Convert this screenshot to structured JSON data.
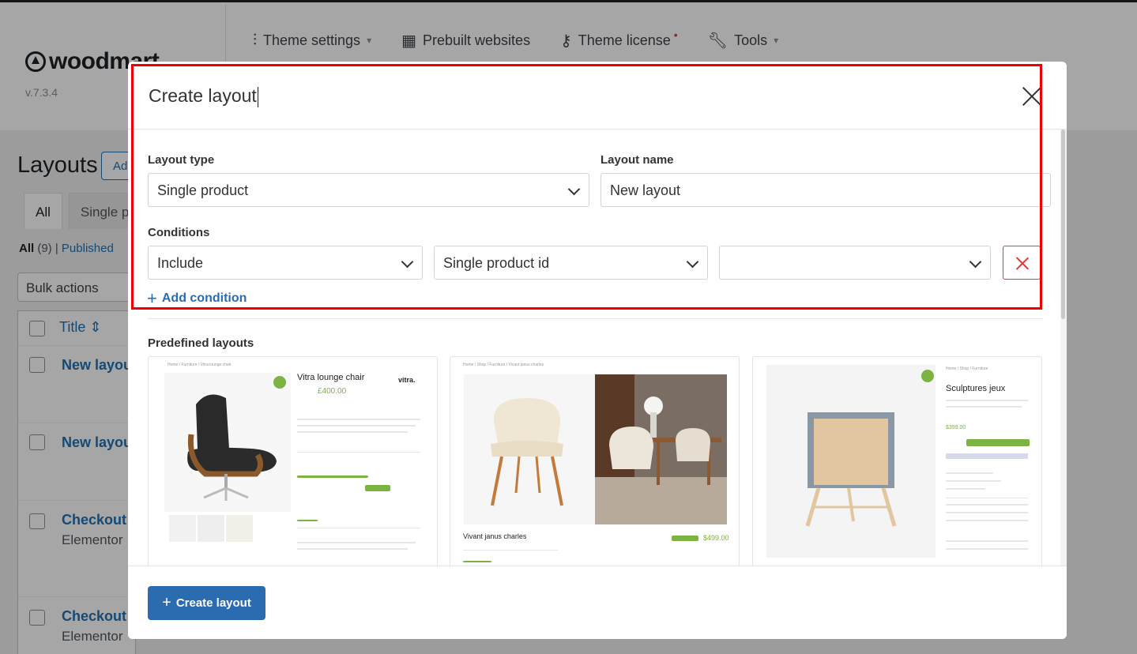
{
  "app": {
    "logo": "woodmart",
    "version": "v.7.3.4",
    "nav": [
      {
        "label": "Theme settings",
        "icon": "sliders-icon"
      },
      {
        "label": "Prebuilt websites",
        "icon": "grid-icon"
      },
      {
        "label": "Theme license",
        "icon": "key-icon"
      },
      {
        "label": "Tools",
        "icon": "wrench-icon"
      }
    ]
  },
  "background": {
    "page_title": "Layouts",
    "add_new": "Ad",
    "tabs": [
      "All",
      "Single p"
    ],
    "filter_all": "All",
    "filter_count": "(9)",
    "filter_published": "Published",
    "bulk_actions": "Bulk actions",
    "column_title": "Title",
    "rows": [
      {
        "title": "New layou",
        "sub": ""
      },
      {
        "title": "New layou",
        "sub": ""
      },
      {
        "title": "Checkout l",
        "sub": "Elementor"
      },
      {
        "title": "Checkout t",
        "sub": "Elementor"
      }
    ]
  },
  "modal": {
    "title": "Create layout",
    "layout_type_label": "Layout type",
    "layout_type_value": "Single product",
    "layout_name_label": "Layout name",
    "layout_name_value": "New layout",
    "conditions_label": "Conditions",
    "condition": {
      "comparison": "Include",
      "type": "Single product id",
      "value": ""
    },
    "add_condition": "Add condition",
    "predefined_label": "Predefined layouts",
    "predefined": [
      {
        "title": "Vitra lounge chair",
        "price": "£400.00",
        "brand": "vitra."
      },
      {
        "title": "Vivant janus charles",
        "price": "$499.00"
      },
      {
        "title": "Sculptures jeux",
        "price": "$399.00"
      }
    ],
    "create_button": "Create layout"
  },
  "colors": {
    "primary": "#2b6cb0",
    "danger": "#e03b3b",
    "highlight": "#ee0000",
    "accent_green": "#7cb342"
  }
}
